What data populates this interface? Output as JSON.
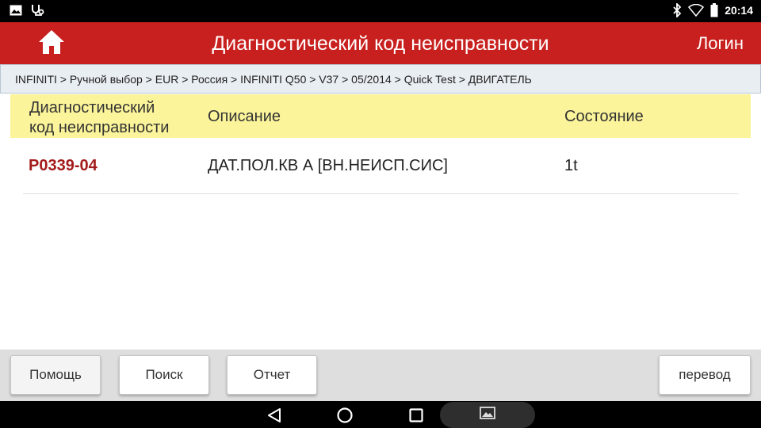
{
  "status_bar": {
    "left_icons": [
      "image-icon",
      "usb-debug-icon"
    ],
    "right_icons": [
      "bluetooth-icon",
      "wifi-icon",
      "battery-icon"
    ],
    "time": "20:14"
  },
  "header": {
    "title": "Диагностический код неисправности",
    "login_label": "Логин",
    "home_icon": "home-icon",
    "background_color": "#c8201e"
  },
  "breadcrumb": {
    "text": "INFINITI > Ручной выбор > EUR > Россия > INFINITI Q50 > V37 > 05/2014 > Quick Test > ДВИГАТЕЛЬ"
  },
  "table": {
    "headers": {
      "code_line1": "Диагностический",
      "code_line2": "код неисправности",
      "description": "Описание",
      "status": "Состояние"
    },
    "rows": [
      {
        "code": "P0339-04",
        "description": "ДАТ.ПОЛ.КВ А [ВН.НЕИСП.СИС]",
        "status": "1t"
      }
    ],
    "header_color": "#fbf49a",
    "code_color": "#a31b1b"
  },
  "toolbar": {
    "help_label": "Помощь",
    "search_label": "Поиск",
    "report_label": "Отчет",
    "translate_label": "перевод"
  },
  "nav_bar": {
    "icons": [
      "back-icon",
      "home-circle-icon",
      "recent-apps-icon",
      "screenshot-icon"
    ]
  }
}
